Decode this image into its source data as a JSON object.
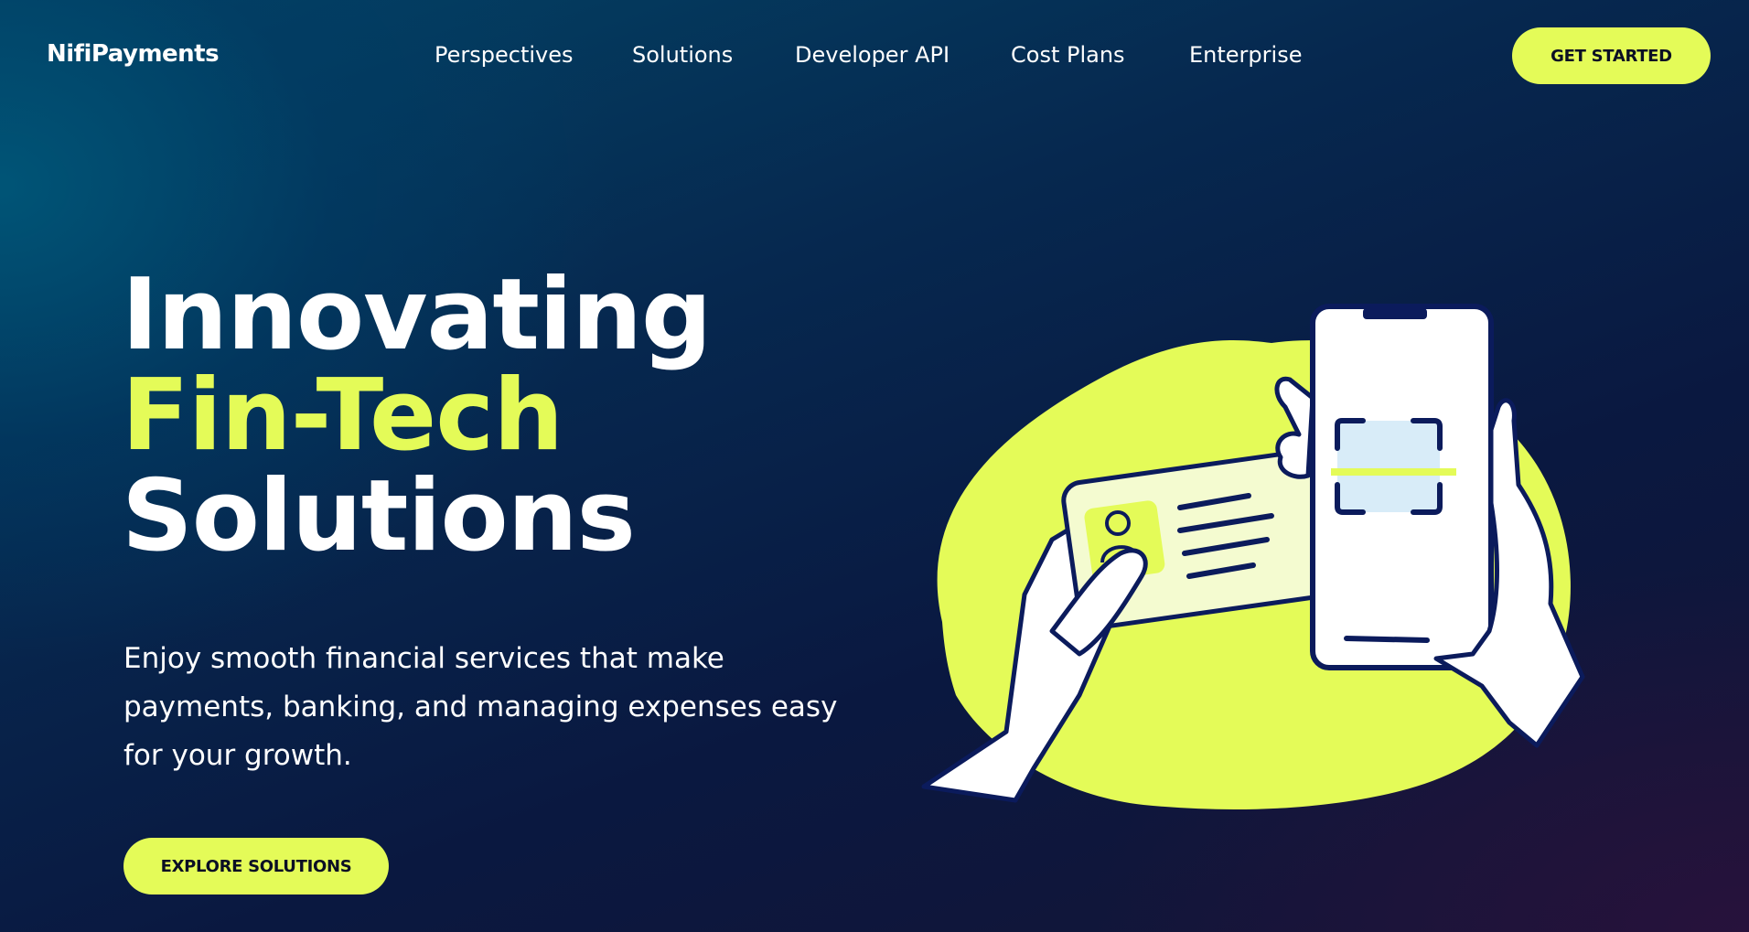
{
  "brand": {
    "name": "NifiPayments"
  },
  "nav": {
    "items": [
      {
        "label": "Perspectives"
      },
      {
        "label": "Solutions"
      },
      {
        "label": "Developer API"
      },
      {
        "label": "Cost Plans"
      },
      {
        "label": "Enterprise"
      }
    ]
  },
  "header": {
    "cta_label": "GET STARTED"
  },
  "hero": {
    "title_line1": "Innovating",
    "title_line2": "Fin-Tech",
    "title_line3": "Solutions",
    "subtitle": "Enjoy smooth financial services that make payments, banking, and managing expenses easy for your growth.",
    "cta_label": "EXPLORE SOLUTIONS"
  },
  "colors": {
    "accent": "#e4fb58",
    "background_dark": "#0a1840",
    "background_teal": "#034466",
    "illustration_outline": "#0b1b5c",
    "scan_area": "#d8ecf8"
  },
  "icons": {
    "illustration": "hand-holding-phone-scanning-id-card-illustration"
  }
}
